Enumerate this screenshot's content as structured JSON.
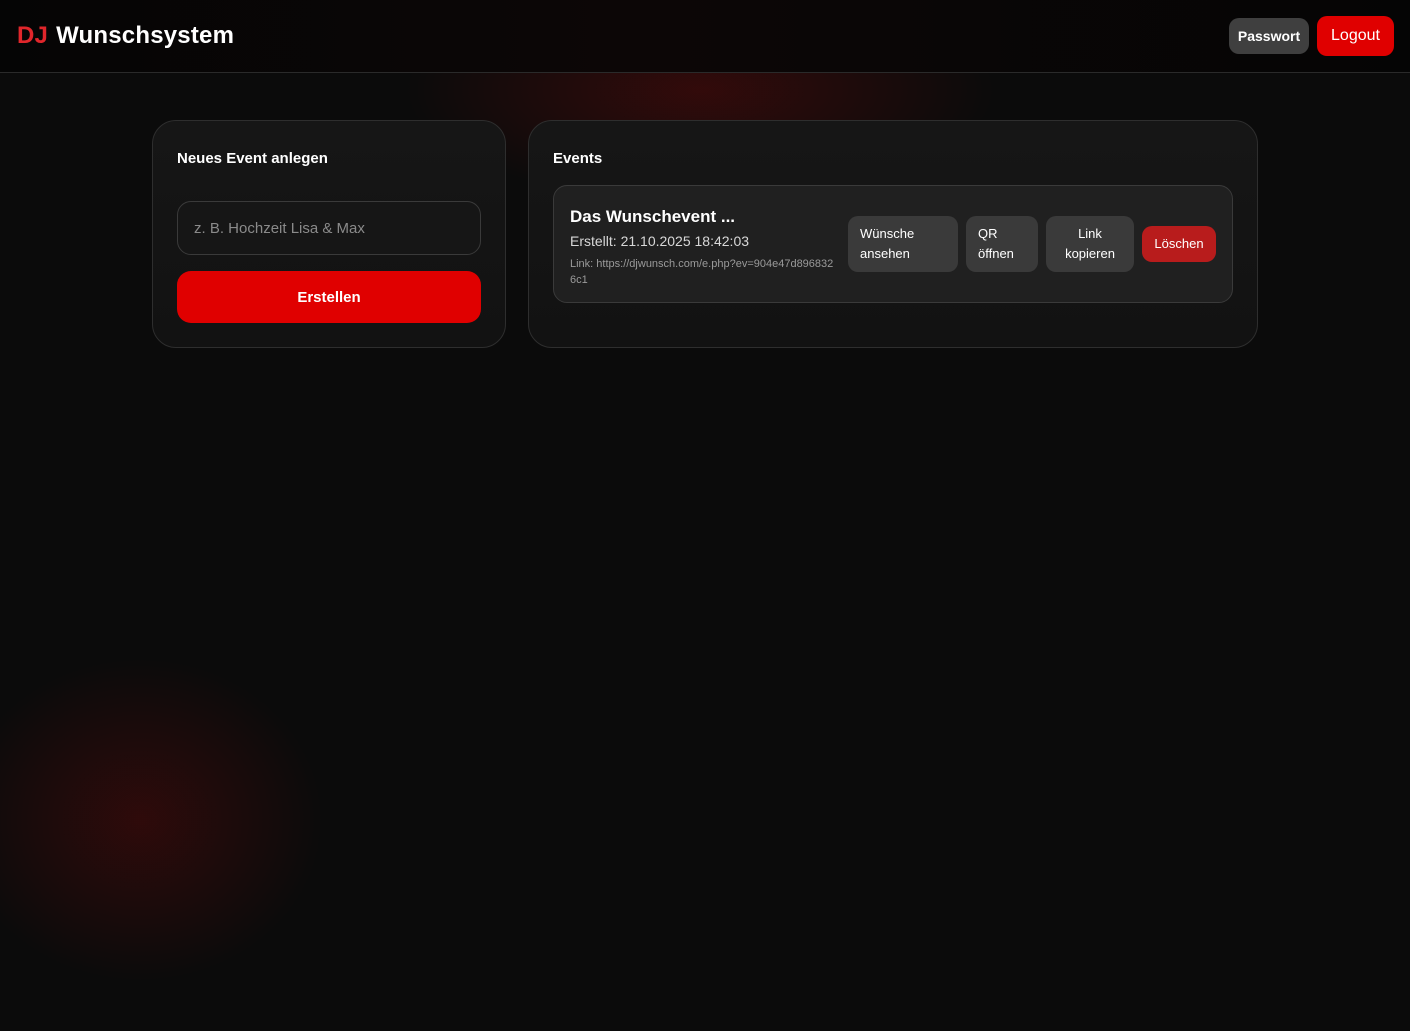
{
  "header": {
    "brand_prefix": "DJ",
    "brand_name": "Wunschsystem",
    "password_label": "Passwort",
    "logout_label": "Logout"
  },
  "new_event": {
    "title": "Neues Event anlegen",
    "input_placeholder": "z. B. Hochzeit Lisa & Max",
    "input_value": "",
    "create_label": "Erstellen"
  },
  "events": {
    "title": "Events",
    "items": [
      {
        "name": "Das Wunschevent ...",
        "created": "Erstellt: 21.10.2025 18:42:03",
        "link": "Link: https://djwunsch.com/e.php?ev=904e47d8968326c1",
        "actions": {
          "wishes": "Wünsche ansehen",
          "qr": "QR öffnen",
          "copy_link": "Link kopieren",
          "delete": "Löschen"
        }
      }
    ]
  },
  "colors": {
    "accent_red": "#e00000",
    "brand_red": "#e0262b",
    "delete_red": "#b81c1c",
    "background": "#0b0b0b"
  }
}
